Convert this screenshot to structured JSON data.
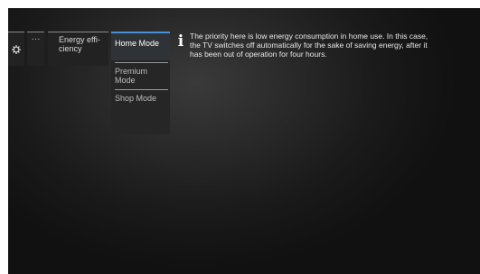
{
  "menu": {
    "settings_icon": "gear-icon",
    "more_label": "···",
    "energy_label": "Energy effi-\nciency"
  },
  "modes": [
    {
      "label": "Home Mode",
      "selected": true
    },
    {
      "label": "Premium\nMode",
      "selected": false
    },
    {
      "label": "Shop Mode",
      "selected": false
    }
  ],
  "info": {
    "icon": "info-icon",
    "text": "The priority here is low energy consumption in home use. In this case, the TV switches off automatically for the sake of saving energy, after it has been out of operation for four hours."
  },
  "colors": {
    "accent": "#4a90d9",
    "panel_bg": "#222222",
    "border": "#ffffff"
  }
}
